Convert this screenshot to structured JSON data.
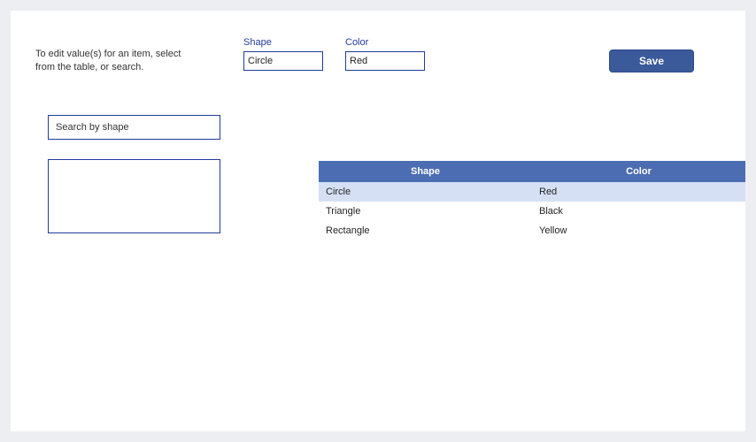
{
  "instructions": "To edit value(s) for an item, select from the table, or search.",
  "fields": {
    "shape": {
      "label": "Shape",
      "value": "Circle"
    },
    "color": {
      "label": "Color",
      "value": "Red"
    }
  },
  "save_label": "Save",
  "search": {
    "placeholder": "Search by shape"
  },
  "table": {
    "headers": {
      "shape": "Shape",
      "color": "Color"
    },
    "rows": [
      {
        "shape": "Circle",
        "color": "Red",
        "selected": true
      },
      {
        "shape": "Triangle",
        "color": "Black",
        "selected": false
      },
      {
        "shape": "Rectangle",
        "color": "Yellow",
        "selected": false
      }
    ]
  }
}
